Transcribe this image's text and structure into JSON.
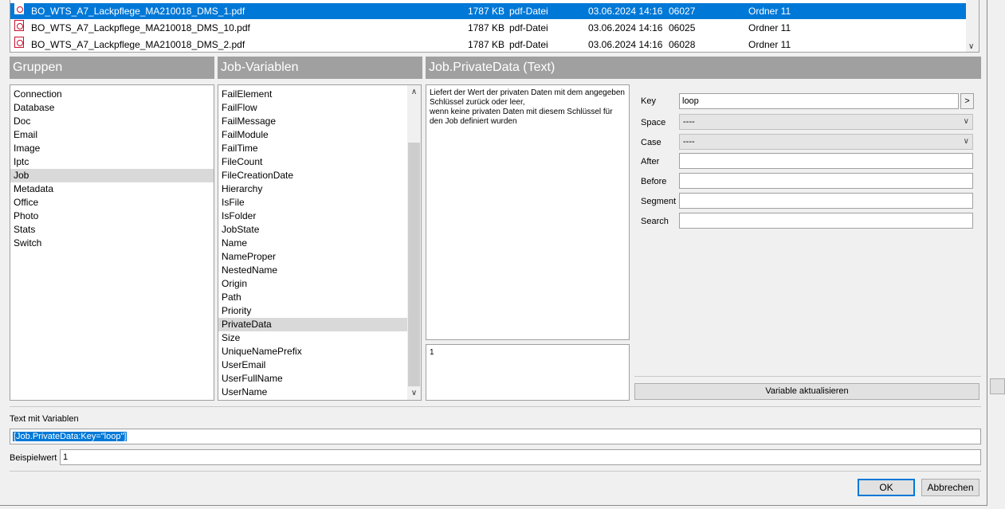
{
  "files": {
    "rows": [
      {
        "name": "BO_WTS_A7_Lackpflege_MA210018_DMS_1.pdf",
        "size": "1787 KB",
        "type": "pdf-Datei",
        "date": "03.06.2024 14:16",
        "number": "06027",
        "folder": "Ordner 11",
        "selected": true
      },
      {
        "name": "BO_WTS_A7_Lackpflege_MA210018_DMS_10.pdf",
        "size": "1787 KB",
        "type": "pdf-Datei",
        "date": "03.06.2024 14:16",
        "number": "06025",
        "folder": "Ordner 11",
        "selected": false
      },
      {
        "name": "BO_WTS_A7_Lackpflege_MA210018_DMS_2.pdf",
        "size": "1787 KB",
        "type": "pdf-Datei",
        "date": "03.06.2024 14:16",
        "number": "06028",
        "folder": "Ordner 11",
        "selected": false
      }
    ]
  },
  "groups": {
    "header": "Gruppen",
    "items": [
      "Connection",
      "Database",
      "Doc",
      "Email",
      "Image",
      "Iptc",
      "Job",
      "Metadata",
      "Office",
      "Photo",
      "Stats",
      "Switch"
    ],
    "selected": "Job"
  },
  "variables": {
    "header": "Job-Variablen",
    "items": [
      "FailElement",
      "FailFlow",
      "FailMessage",
      "FailModule",
      "FailTime",
      "FileCount",
      "FileCreationDate",
      "Hierarchy",
      "IsFile",
      "IsFolder",
      "JobState",
      "Name",
      "NameProper",
      "NestedName",
      "Origin",
      "Path",
      "Priority",
      "PrivateData",
      "Size",
      "UniqueNamePrefix",
      "UserEmail",
      "UserFullName",
      "UserName"
    ],
    "selected": "PrivateData"
  },
  "detail": {
    "header": "Job.PrivateData (Text)",
    "description": "Liefert der Wert der privaten Daten mit dem angegeben Schlüssel zurück oder leer,\nwenn keine privaten Daten mit diesem Schlüssel für den Job definiert wurden",
    "sample_output": "1"
  },
  "form": {
    "key_label": "Key",
    "key_value": "loop",
    "key_button": ">",
    "space_label": "Space",
    "space_value": "----",
    "case_label": "Case",
    "case_value": "----",
    "after_label": "After",
    "after_value": "",
    "before_label": "Before",
    "before_value": "",
    "segment_label": "Segment",
    "segment_value": "",
    "search_label": "Search",
    "search_value": "",
    "update_button": "Variable aktualisieren"
  },
  "text_with_variables": {
    "label": "Text mit Variablen",
    "value": "[Job.PrivateData:Key=\"loop\"]"
  },
  "example_value": {
    "label": "Beispielwert",
    "value": "1"
  },
  "buttons": {
    "ok": "OK",
    "cancel": "Abbrechen"
  }
}
